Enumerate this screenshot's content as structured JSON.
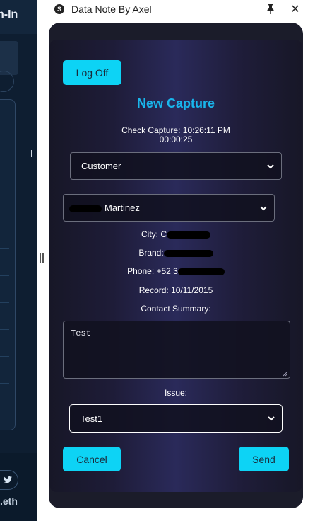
{
  "window": {
    "title": "Data Note By Axel",
    "close_label": "✕"
  },
  "background_app": {
    "header_fragment": "n-In",
    "footer_fragment": ".eth"
  },
  "form": {
    "logoff_label": "Log Off",
    "heading": "New Capture",
    "check_capture": "Check Capture: 10:26:11 PM",
    "elapsed": "00:00:25",
    "type_selected": "Customer",
    "customer_selected": "Martinez",
    "city_label": "City: C",
    "brand_label": "Brand:",
    "phone_label": "Phone: +52 3",
    "record_label": "Record: 10/11/2015",
    "contact_summary_label": "Contact Summary:",
    "contact_summary_value": "Test",
    "issue_label": "Issue:",
    "issue_selected": "Test1",
    "cancel_label": "Cancel",
    "send_label": "Send"
  },
  "colors": {
    "accent": "#0dd3f5",
    "heading": "#19b6ec",
    "card_center": "#2a2a5a",
    "card_edge": "#171727"
  }
}
